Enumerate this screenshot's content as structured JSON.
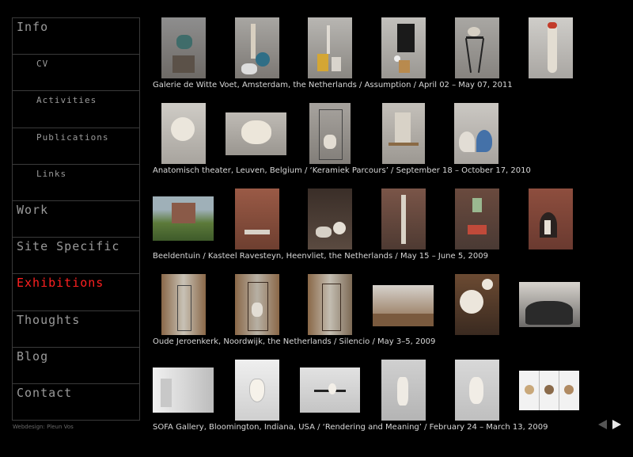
{
  "nav": {
    "items": [
      {
        "label": "Info",
        "level": "main",
        "active": false
      },
      {
        "label": "CV",
        "level": "sub",
        "active": false
      },
      {
        "label": "Activities",
        "level": "sub",
        "active": false
      },
      {
        "label": "Publications",
        "level": "sub",
        "active": false
      },
      {
        "label": "Links",
        "level": "sub",
        "active": false
      },
      {
        "label": "Work",
        "level": "main",
        "active": false
      },
      {
        "label": "Site Specific",
        "level": "main",
        "active": false
      },
      {
        "label": "Exhibitions",
        "level": "main",
        "active": true
      },
      {
        "label": "Thoughts",
        "level": "main",
        "active": false
      },
      {
        "label": "Blog",
        "level": "main",
        "active": false
      },
      {
        "label": "Contact",
        "level": "main",
        "active": false
      }
    ]
  },
  "credit": "Webdesign: Pleun Vos",
  "exhibitions": [
    {
      "caption": "Galerie de Witte Voet, Amsterdam, the Netherlands / Assumption / April 02 – May 07, 2011"
    },
    {
      "caption": "Anatomisch theater, Leuven, Belgium / ‘Keramiek Parcours’ / September 18 – October 17, 2010"
    },
    {
      "caption": "Beeldentuin / Kasteel Ravesteyn, Heenvliet, the Netherlands / May 15 – June 5, 2009"
    },
    {
      "caption": "Oude Jeroenkerk, Noordwijk, the Netherlands / Silencio / May 3–5, 2009"
    },
    {
      "caption": "SOFA Gallery, Bloomington, Indiana, USA / ‘Rendering and Meaning’ / February 24 – March 13, 2009"
    }
  ],
  "colors": {
    "background": "#000000",
    "nav_text": "#9a9a9a",
    "active": "#ff2020",
    "border": "#3a3a3a"
  }
}
